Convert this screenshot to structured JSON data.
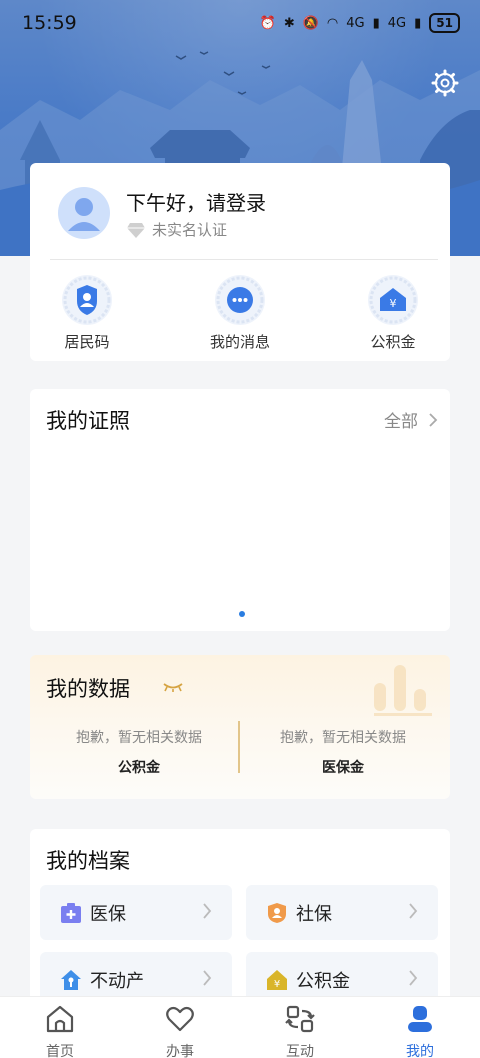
{
  "status_bar": {
    "time": "15:59",
    "battery": "51",
    "net1": "4G",
    "net2": "4G"
  },
  "user": {
    "greeting": "下午好，请登录",
    "verify_status": "未实名认证"
  },
  "quick_actions": [
    {
      "label": "居民码",
      "icon": "resident-code-icon"
    },
    {
      "label": "我的消息",
      "icon": "message-icon"
    },
    {
      "label": "公积金",
      "icon": "provident-fund-icon"
    }
  ],
  "certificates": {
    "title": "我的证照",
    "all_label": "全部"
  },
  "my_data": {
    "title": "我的数据",
    "items": [
      {
        "message": "抱歉，暂无相关数据",
        "name": "公积金"
      },
      {
        "message": "抱歉，暂无相关数据",
        "name": "医保金"
      }
    ]
  },
  "archives": {
    "title": "我的档案",
    "items": [
      {
        "label": "医保",
        "icon": "medical-insurance-icon",
        "color": "#7a7ff0"
      },
      {
        "label": "社保",
        "icon": "social-security-icon",
        "color": "#f09a4a"
      },
      {
        "label": "不动产",
        "icon": "real-estate-icon",
        "color": "#3f8fe8"
      },
      {
        "label": "公积金",
        "icon": "provident-fund-icon",
        "color": "#d9b52a"
      }
    ]
  },
  "tabs": [
    {
      "label": "首页",
      "icon": "home-icon"
    },
    {
      "label": "办事",
      "icon": "heart-icon"
    },
    {
      "label": "互动",
      "icon": "interaction-icon"
    },
    {
      "label": "我的",
      "icon": "profile-icon",
      "active": true
    }
  ],
  "colors": {
    "primary": "#2d6fdc",
    "banner": "#4a7bc7",
    "gold": "#e2c58a"
  }
}
